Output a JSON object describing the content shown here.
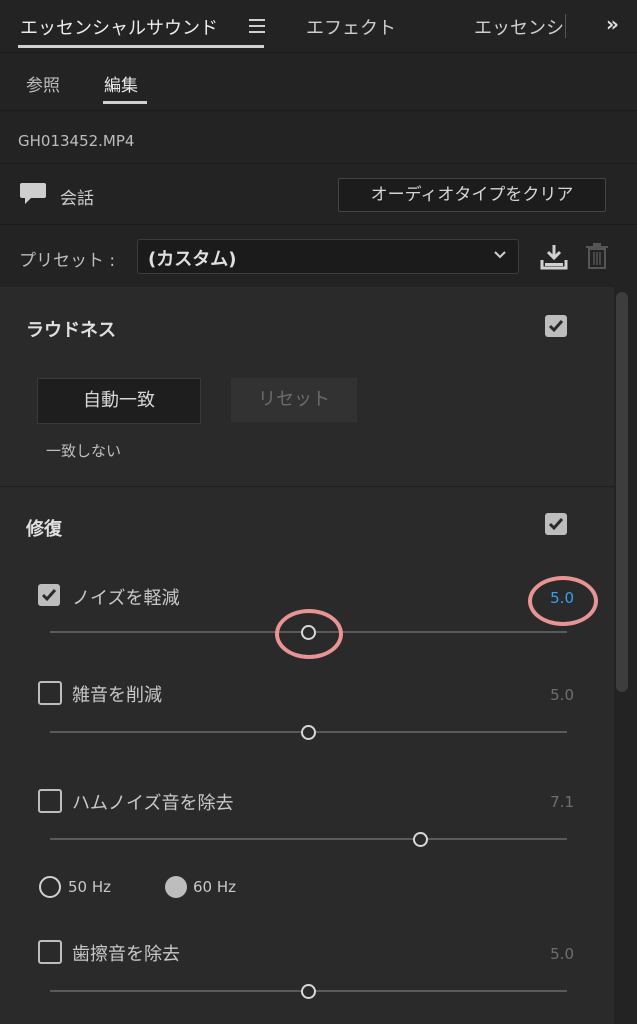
{
  "tabs": {
    "essential_sound": "エッセンシャルサウンド",
    "effects": "エフェクト",
    "essentials_clipped": "エッセンシ",
    "overflow": "»"
  },
  "subtabs": {
    "browse": "参照",
    "edit": "編集"
  },
  "clip": {
    "filename": "GH013452.MP4"
  },
  "audio_type": {
    "label": "会話",
    "clear_button": "オーディオタイプをクリア"
  },
  "preset": {
    "label": "プリセット :",
    "value": "(カスタム)"
  },
  "loudness": {
    "title": "ラウドネス",
    "enabled": true,
    "auto_match": "自動一致",
    "reset": "リセット",
    "status": "一致しない"
  },
  "repair": {
    "title": "修復",
    "enabled": true,
    "items": [
      {
        "label": "ノイズを軽減",
        "checked": true,
        "value": "5.0",
        "slider": 0.5,
        "highlight": true
      },
      {
        "label": "雑音を削減",
        "checked": false,
        "value": "5.0",
        "slider": 0.5
      },
      {
        "label": "ハムノイズ音を除去",
        "checked": false,
        "value": "7.1",
        "slider": 0.71
      },
      {
        "label": "歯擦音を除去",
        "checked": false,
        "value": "5.0",
        "slider": 0.5
      }
    ],
    "hum_freq": {
      "option_50": "50 Hz",
      "option_60": "60 Hz",
      "selected": "60 Hz"
    }
  },
  "colors": {
    "accent": "#3d9fe8",
    "highlight": "#e89494"
  }
}
